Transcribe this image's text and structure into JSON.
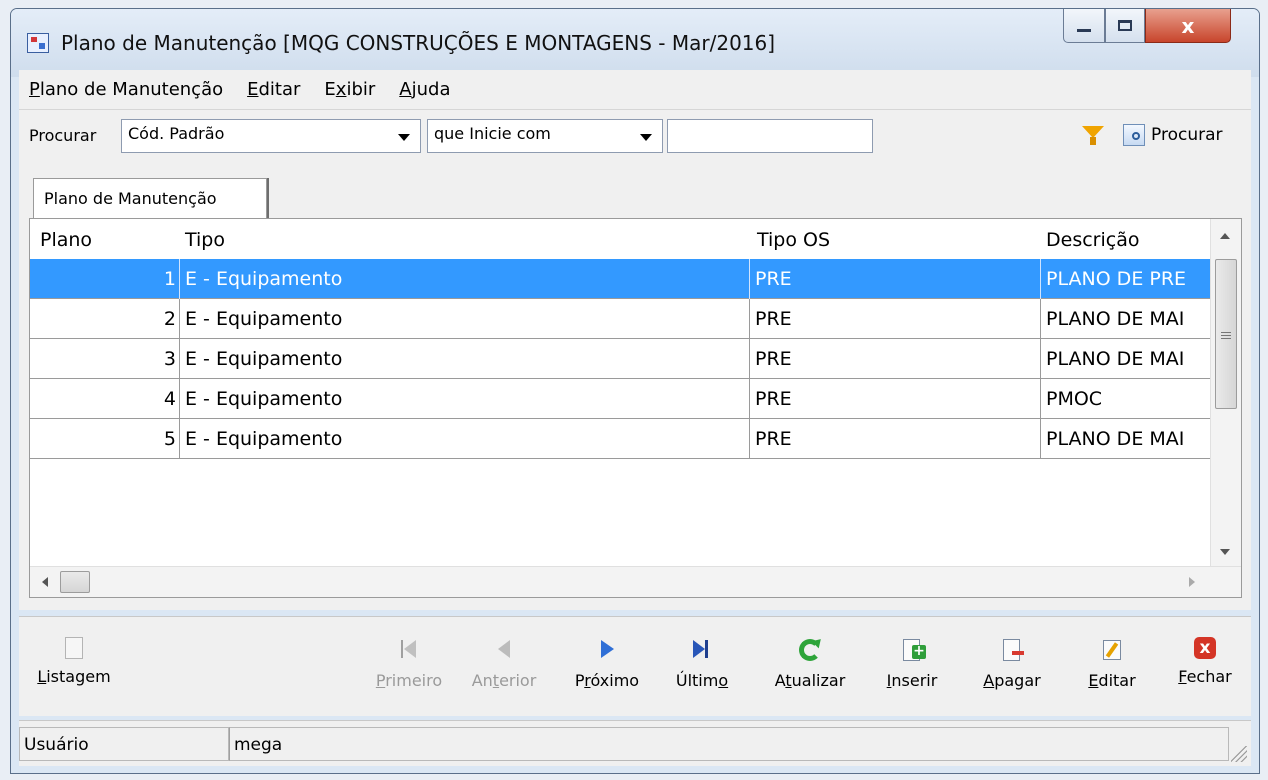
{
  "window": {
    "title": "Plano de Manutenção [MQG CONSTRUÇÕES E MONTAGENS - Mar/2016]",
    "close_glyph": "x"
  },
  "menu": [
    {
      "ul": "P",
      "rest": "lano de Manutenção"
    },
    {
      "ul": "E",
      "rest": "ditar"
    },
    {
      "pre": "E",
      "ul": "x",
      "rest": "ibir"
    },
    {
      "ul": "A",
      "rest": "juda"
    }
  ],
  "search": {
    "label": "Procurar",
    "field_selected": "Cód. Padrão",
    "condition_selected": "que Inicie com",
    "value": "",
    "button_label": "Procurar"
  },
  "tab": {
    "label": "Plano de Manutenção"
  },
  "table": {
    "columns": [
      "Plano",
      "Tipo",
      "Tipo OS",
      "Descrição"
    ],
    "rows": [
      {
        "plano": "1",
        "tipo": "E - Equipamento",
        "tipo_os": "PRE",
        "descricao": "PLANO DE PRE"
      },
      {
        "plano": "2",
        "tipo": "E - Equipamento",
        "tipo_os": "PRE",
        "descricao": "PLANO DE MAI"
      },
      {
        "plano": "3",
        "tipo": "E - Equipamento",
        "tipo_os": "PRE",
        "descricao": "PLANO DE MAI"
      },
      {
        "plano": "4",
        "tipo": "E - Equipamento",
        "tipo_os": "PRE",
        "descricao": "PMOC"
      },
      {
        "plano": "5",
        "tipo": "E - Equipamento",
        "tipo_os": "PRE",
        "descricao": "PLANO DE MAI"
      }
    ],
    "selected_row": "1"
  },
  "toolbar": {
    "listagem": {
      "ul": "L",
      "rest": "istagem"
    },
    "primeiro": {
      "ul": "P",
      "rest": "rimeiro"
    },
    "anterior": {
      "pre": "An",
      "ul": "t",
      "rest": "erior"
    },
    "proximo": {
      "pre": "P",
      "ul": "r",
      "rest": "óximo"
    },
    "ultimo": {
      "pre": "Últim",
      "ul": "o",
      "rest": ""
    },
    "atualizar": {
      "pre": "A",
      "ul": "t",
      "rest": "ualizar"
    },
    "inserir": {
      "ul": "I",
      "rest": "nserir"
    },
    "apagar": {
      "ul": "A",
      "rest": "pagar"
    },
    "editar": {
      "ul": "E",
      "rest": "ditar"
    },
    "fechar": {
      "ul": "F",
      "rest": "echar"
    }
  },
  "status": {
    "user_label": "Usuário",
    "user_value": "mega"
  },
  "colors": {
    "selection": "#3399ff",
    "close_red": "#d43526",
    "refresh_green": "#2ea43a",
    "nav_blue": "#2f6fd6",
    "funnel_orange": "#f0a400"
  }
}
